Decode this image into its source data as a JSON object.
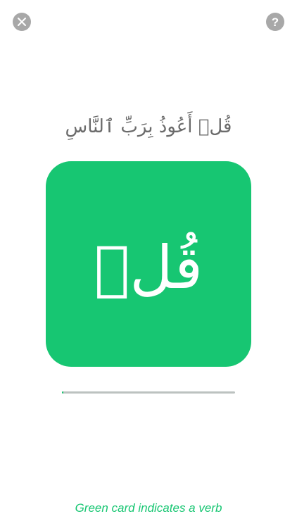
{
  "header": {
    "close_icon": "close-icon",
    "help_icon": "help-icon",
    "help_glyph": "?"
  },
  "verse": {
    "text": "قُلۡ أَعُوذُ بِرَبِّ ٱلنَّاسِ"
  },
  "card": {
    "word": "قُلۡ",
    "color": "#17c672"
  },
  "progress": {
    "value": 0.01
  },
  "hint": {
    "text": "Green card indicates a verb"
  }
}
